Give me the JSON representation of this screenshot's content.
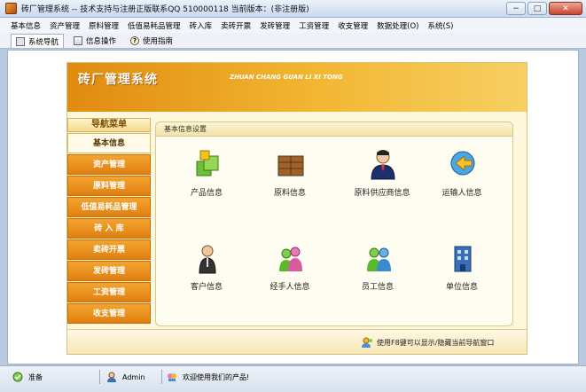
{
  "window": {
    "title": "砖厂管理系统 -- 技术支持与注册正版联系QQ 510000118   当前版本：(非注册版)",
    "buttons": {
      "minimize": "−",
      "maximize": "□",
      "close": "✕"
    }
  },
  "menubar": {
    "items": [
      "基本信息",
      "资产管理",
      "原料管理",
      "低值易耗品管理",
      "砖入库",
      "卖砖开票",
      "发砖管理",
      "工资管理",
      "收支管理",
      "数据处理(O)",
      "系统(S)"
    ]
  },
  "tabs": [
    {
      "label": "系统导航",
      "icon": "navigation-icon"
    },
    {
      "label": "信息操作",
      "icon": "document-icon"
    },
    {
      "label": "使用指南",
      "icon": "help-icon"
    }
  ],
  "banner": {
    "title": "砖厂管理系统",
    "subtitle": "ZHUAN CHANG GUAN LI XI TONG"
  },
  "nav": {
    "header": "导航菜单",
    "items": [
      "基本信息",
      "资产管理",
      "原料管理",
      "低值易耗品管理",
      "砖 入 库",
      "卖砖开票",
      "发砖管理",
      "工资管理",
      "收支管理"
    ],
    "active": "基本信息"
  },
  "content": {
    "header": "基本信息设置",
    "tiles": [
      {
        "label": "产品信息",
        "icon": "product-cubes-icon"
      },
      {
        "label": "原料信息",
        "icon": "material-crate-icon"
      },
      {
        "label": "原料供应商信息",
        "icon": "supplier-person-icon"
      },
      {
        "label": "运输人信息",
        "icon": "transporter-icon"
      },
      {
        "label": "客户信息",
        "icon": "customer-icon"
      },
      {
        "label": "经手人信息",
        "icon": "handler-people-icon"
      },
      {
        "label": "员工信息",
        "icon": "staff-people-icon"
      },
      {
        "label": "单位信息",
        "icon": "company-icon"
      }
    ]
  },
  "footer": {
    "hint": "使用F8键可以显示/隐藏当前导航窗口"
  },
  "statusbar": {
    "status": "准备",
    "user": "Admin",
    "message": "欢迎使用我们的产品!"
  },
  "colors": {
    "accent": "#e8921a",
    "banner_end": "#f7cf63",
    "panel_bg": "#fdf7dc"
  }
}
